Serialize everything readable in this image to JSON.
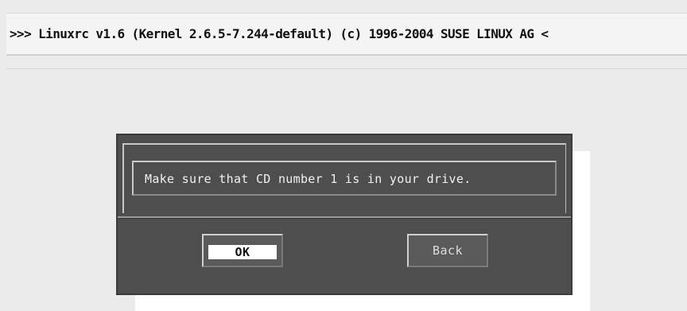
{
  "header": {
    "title": ">>> Linuxrc v1.6 (Kernel 2.6.5-7.244-default) (c) 1996-2004 SUSE LINUX AG <"
  },
  "dialog": {
    "message": "Make sure that CD number 1 is in your drive.",
    "ok_label": "OK",
    "back_label": "Back"
  },
  "colors": {
    "background": "#ebebeb",
    "dialog": "#4e4e4e",
    "selected_button": "#ffffff"
  }
}
